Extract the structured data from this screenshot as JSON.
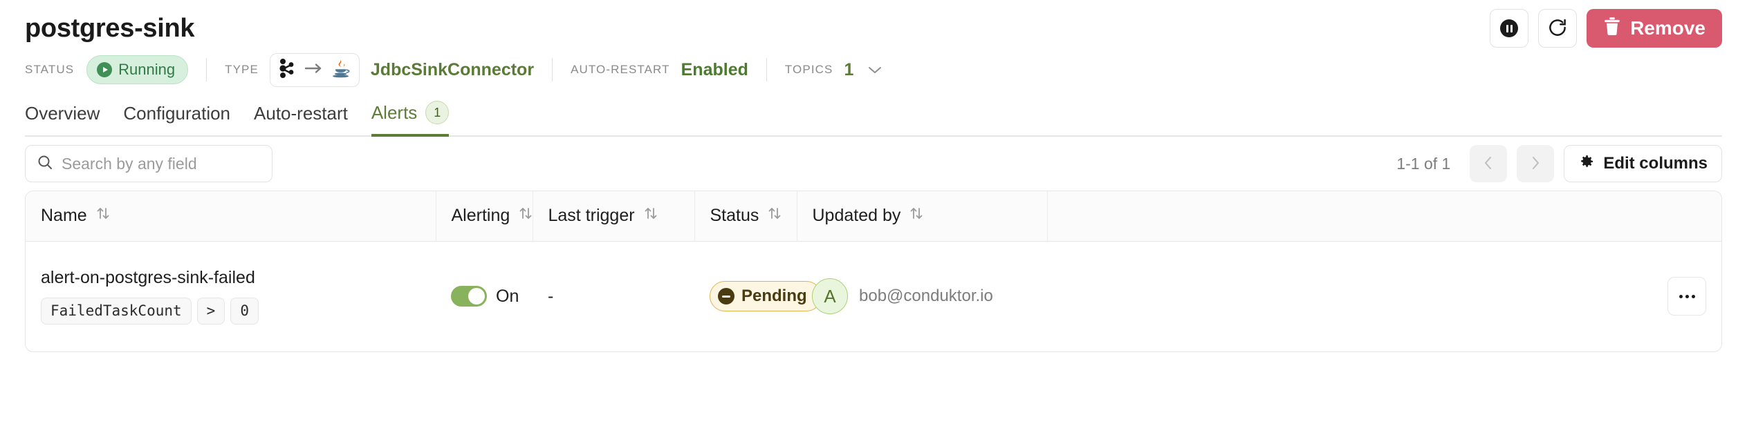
{
  "header": {
    "title": "postgres-sink",
    "actions": {
      "pause_label": "Pause",
      "restart_label": "Restart",
      "remove_label": "Remove"
    }
  },
  "status_strip": {
    "status_label": "STATUS",
    "status_value": "Running",
    "type_label": "TYPE",
    "type_value": "JdbcSinkConnector",
    "type_icons": [
      "kafka-icon",
      "arrow-right-icon",
      "java-icon"
    ],
    "auto_restart_label": "AUTO-RESTART",
    "auto_restart_value": "Enabled",
    "topics_label": "TOPICS",
    "topics_value": "1"
  },
  "tabs": [
    {
      "label": "Overview",
      "active": false,
      "badge": null
    },
    {
      "label": "Configuration",
      "active": false,
      "badge": null
    },
    {
      "label": "Auto-restart",
      "active": false,
      "badge": null
    },
    {
      "label": "Alerts",
      "active": true,
      "badge": "1"
    }
  ],
  "toolbar": {
    "search_placeholder": "Search by any field",
    "search_value": "",
    "pagination_text": "1-1 of 1",
    "prev_label": "Previous page",
    "next_label": "Next page",
    "edit_columns_label": "Edit columns"
  },
  "table": {
    "columns": [
      {
        "label": "Name",
        "sortable": true
      },
      {
        "label": "Alerting",
        "sortable": true
      },
      {
        "label": "Last trigger",
        "sortable": true
      },
      {
        "label": "Status",
        "sortable": true
      },
      {
        "label": "Updated by",
        "sortable": true
      },
      {
        "label": "",
        "sortable": false
      }
    ],
    "rows": [
      {
        "name": "alert-on-postgres-sink-failed",
        "condition_metric": "FailedTaskCount",
        "condition_operator": ">",
        "condition_value": "0",
        "alerting_state": "On",
        "alerting_on": true,
        "last_trigger": "-",
        "status": "Pending",
        "updated_by_initial": "A",
        "updated_by": "bob@conduktor.io",
        "row_menu_label": "Row actions"
      }
    ]
  },
  "colors": {
    "accent_green": "#5d7c36",
    "running_green": "#2f7a45",
    "remove_red": "#d9596e",
    "pending_amber": "#e0b44b",
    "toggle_green": "#88b35c"
  }
}
